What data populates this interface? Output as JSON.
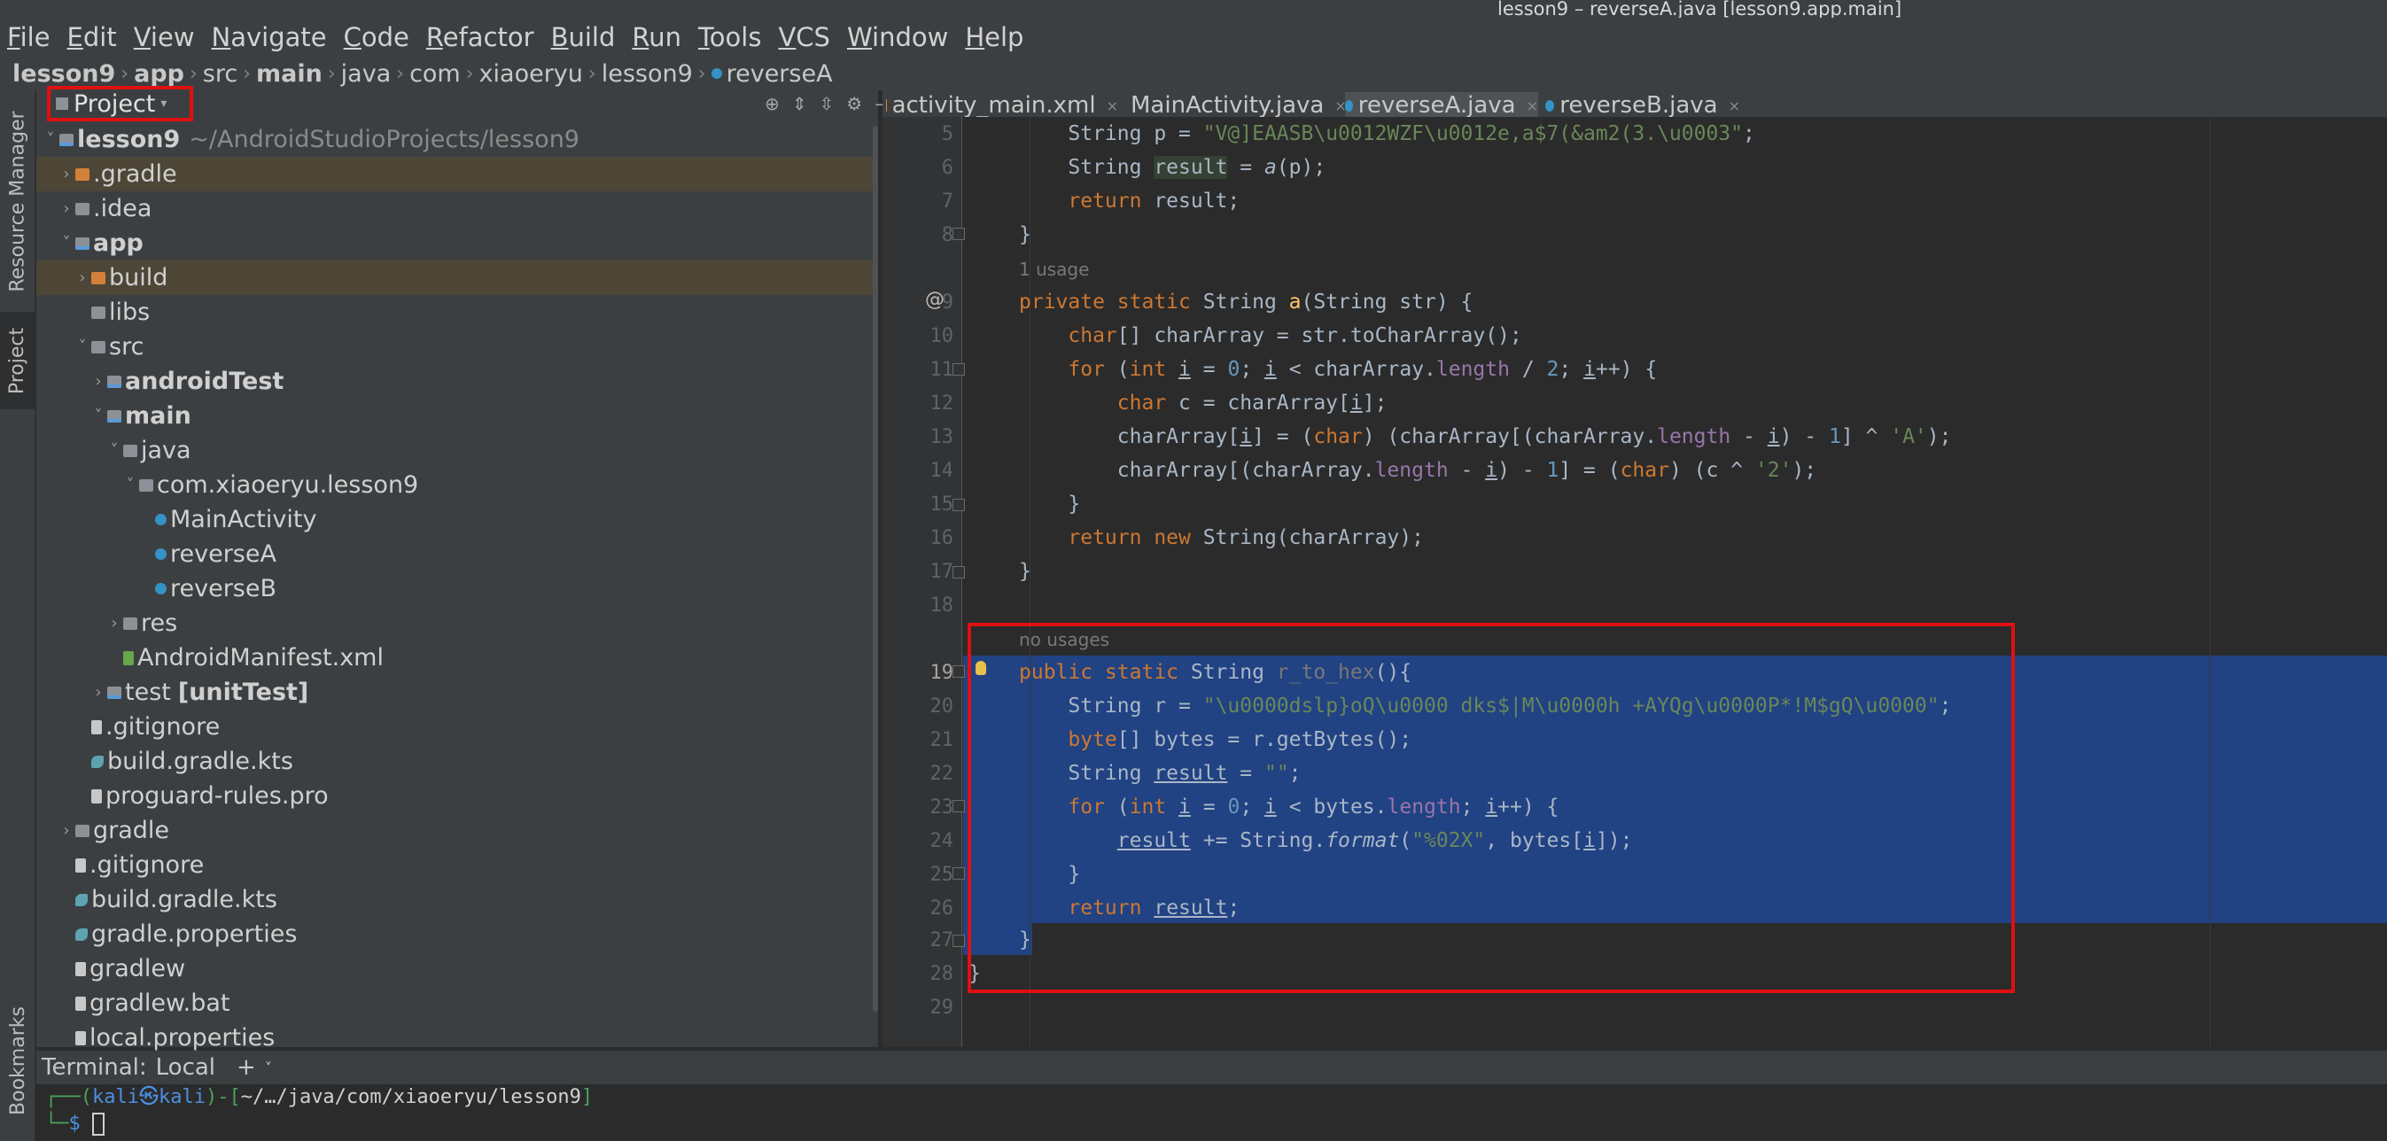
{
  "window": {
    "title": "lesson9 – reverseA.java [lesson9.app.main]"
  },
  "menu": [
    "File",
    "Edit",
    "View",
    "Navigate",
    "Code",
    "Refactor",
    "Build",
    "Run",
    "Tools",
    "VCS",
    "Window",
    "Help"
  ],
  "breadcrumb": [
    "lesson9",
    "app",
    "src",
    "main",
    "java",
    "com",
    "xiaoeryu",
    "lesson9",
    "reverseA"
  ],
  "toolstrip": {
    "resource_manager": "Resource Manager",
    "project": "Project",
    "bookmarks": "Bookmarks"
  },
  "project_panel": {
    "title": "Project",
    "tree": [
      {
        "label": "lesson9",
        "suffix": "~/AndroidStudioProjects/lesson9",
        "depth": 0,
        "arrow": "˅",
        "icon": "mod",
        "bold": true
      },
      {
        "label": ".gradle",
        "depth": 1,
        "arrow": "›",
        "icon": "orange",
        "hl": true
      },
      {
        "label": ".idea",
        "depth": 1,
        "arrow": "›",
        "icon": "folder"
      },
      {
        "label": "app",
        "depth": 1,
        "arrow": "˅",
        "icon": "mod",
        "bold": true
      },
      {
        "label": "build",
        "depth": 2,
        "arrow": "›",
        "icon": "orange",
        "hl": true
      },
      {
        "label": "libs",
        "depth": 2,
        "arrow": "",
        "icon": "folder"
      },
      {
        "label": "src",
        "depth": 2,
        "arrow": "˅",
        "icon": "folder"
      },
      {
        "label": "androidTest",
        "depth": 3,
        "arrow": "›",
        "icon": "mod",
        "bold": true
      },
      {
        "label": "main",
        "depth": 3,
        "arrow": "˅",
        "icon": "mod",
        "bold": true
      },
      {
        "label": "java",
        "depth": 4,
        "arrow": "˅",
        "icon": "folder"
      },
      {
        "label": "com.xiaoeryu.lesson9",
        "depth": 5,
        "arrow": "˅",
        "icon": "folder"
      },
      {
        "label": "MainActivity",
        "depth": 6,
        "arrow": "",
        "icon": "cls"
      },
      {
        "label": "reverseA",
        "depth": 6,
        "arrow": "",
        "icon": "cls"
      },
      {
        "label": "reverseB",
        "depth": 6,
        "arrow": "",
        "icon": "cls"
      },
      {
        "label": "res",
        "depth": 4,
        "arrow": "›",
        "icon": "folder"
      },
      {
        "label": "AndroidManifest.xml",
        "depth": 4,
        "arrow": "",
        "icon": "green"
      },
      {
        "label": "test",
        "bold_suffix": "[unitTest]",
        "depth": 3,
        "arrow": "›",
        "icon": "mod"
      },
      {
        "label": ".gitignore",
        "depth": 2,
        "arrow": "",
        "icon": "file"
      },
      {
        "label": "build.gradle.kts",
        "depth": 2,
        "arrow": "",
        "icon": "gradle"
      },
      {
        "label": "proguard-rules.pro",
        "depth": 2,
        "arrow": "",
        "icon": "file"
      },
      {
        "label": "gradle",
        "depth": 1,
        "arrow": "›",
        "icon": "folder"
      },
      {
        "label": ".gitignore",
        "depth": 1,
        "arrow": "",
        "icon": "file"
      },
      {
        "label": "build.gradle.kts",
        "depth": 1,
        "arrow": "",
        "icon": "gradle"
      },
      {
        "label": "gradle.properties",
        "depth": 1,
        "arrow": "",
        "icon": "gradle"
      },
      {
        "label": "gradlew",
        "depth": 1,
        "arrow": "",
        "icon": "file"
      },
      {
        "label": "gradlew.bat",
        "depth": 1,
        "arrow": "",
        "icon": "file"
      },
      {
        "label": "local.properties",
        "depth": 1,
        "arrow": "",
        "icon": "file"
      }
    ]
  },
  "tabs": [
    {
      "label": "activity_main.xml",
      "icon": "xml",
      "active": false
    },
    {
      "label": "MainActivity.java",
      "icon": "class",
      "active": false
    },
    {
      "label": "reverseA.java",
      "icon": "class",
      "active": true
    },
    {
      "label": "reverseB.java",
      "icon": "class",
      "active": false
    }
  ],
  "editor": {
    "line_numbers": [
      "5",
      "6",
      "7",
      "8",
      "9",
      "10",
      "11",
      "12",
      "13",
      "14",
      "15",
      "16",
      "17",
      "18",
      "19",
      "20",
      "21",
      "22",
      "23",
      "24",
      "25",
      "26",
      "27",
      "28",
      "29"
    ],
    "usage_hint_1": "1 usage",
    "usage_hint_2": "no usages"
  },
  "terminal": {
    "label": "Terminal:",
    "session": "Local",
    "prompt_user": "kali",
    "prompt_host": "kali",
    "prompt_path": "~/…/java/com/xiaoeryu/lesson9"
  }
}
